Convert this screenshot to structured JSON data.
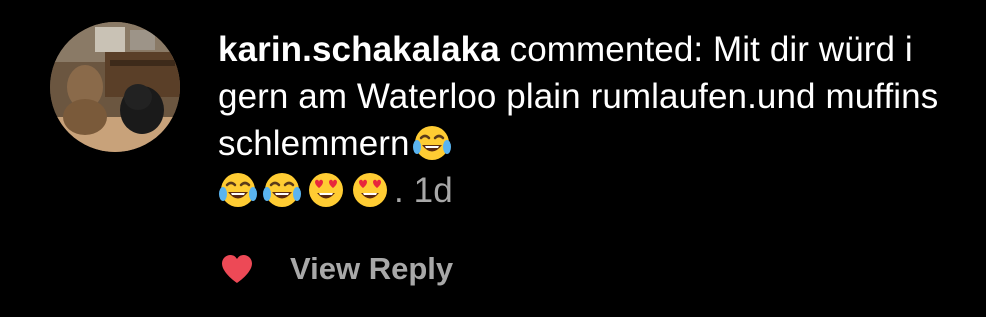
{
  "comment": {
    "username": "karin.schakalaka",
    "text": " commented: Mit dir würd i gern am Waterloo plain rumlaufen.und muffins schlemmern",
    "emojis_inline": [
      "face-with-tears-of-joy"
    ],
    "emojis_trailing": [
      "face-with-tears-of-joy",
      "face-with-tears-of-joy",
      "smiling-face-with-heart-eyes",
      "smiling-face-with-heart-eyes"
    ],
    "separator": ". ",
    "time": "1d"
  },
  "actions": {
    "like_icon": "heart-icon",
    "like_color": "#ed4956",
    "reply_label": "View Reply"
  },
  "colors": {
    "background": "#000000",
    "text": "#ffffff",
    "secondary": "#a8a8a8"
  }
}
